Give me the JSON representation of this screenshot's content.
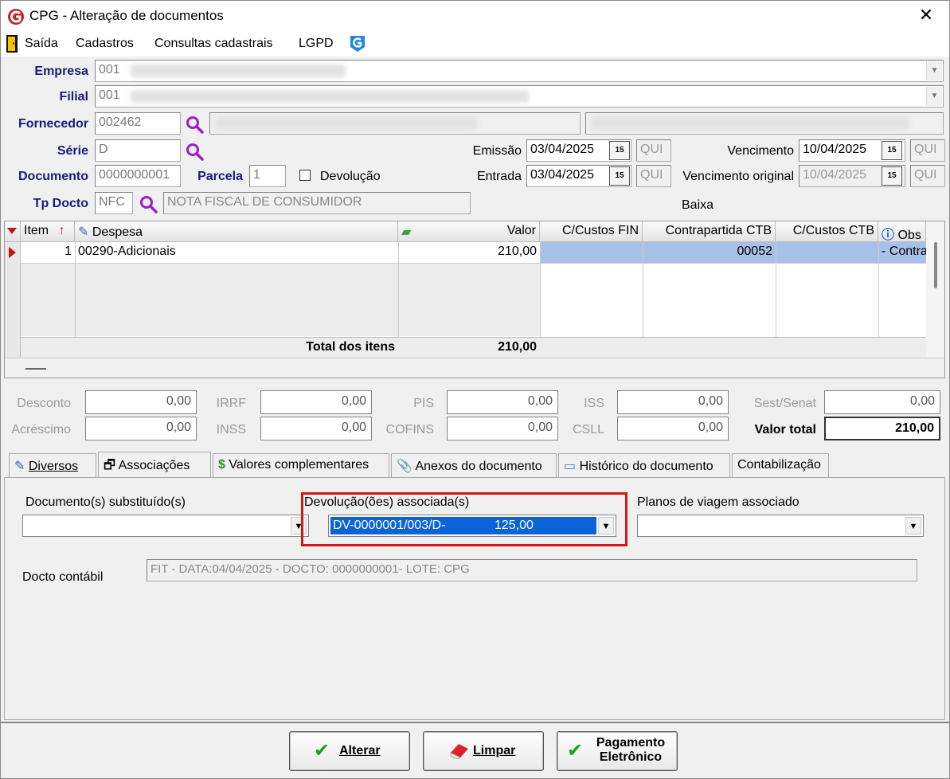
{
  "window": {
    "title": "CPG - Alteração de documentos",
    "close_label": "✕"
  },
  "menu": {
    "items": [
      "Saída",
      "Cadastros",
      "Consultas cadastrais",
      "LGPD"
    ]
  },
  "header": {
    "empresa_label": "Empresa",
    "empresa_value": "001",
    "filial_label": "Filial",
    "filial_value": "001",
    "fornecedor_label": "Fornecedor",
    "fornecedor_value": "002462",
    "serie_label": "Série",
    "serie_value": "D",
    "documento_label": "Documento",
    "documento_value": "0000000001",
    "parcela_label": "Parcela",
    "parcela_value": "1",
    "devolucao_label": "Devolução",
    "tpdocto_label": "Tp Docto",
    "tpdocto_value": "NFC",
    "tpdocto_desc": "NOTA FISCAL DE CONSUMIDOR",
    "emissao_label": "Emissão",
    "emissao_value": "03/04/2025",
    "emissao_day": "QUI",
    "entrada_label": "Entrada",
    "entrada_value": "03/04/2025",
    "entrada_day": "QUI",
    "vencimento_label": "Vencimento",
    "vencimento_value": "10/04/2025",
    "vencimento_day": "QUI",
    "venc_original_label": "Vencimento original",
    "venc_original_value": "10/04/2025",
    "venc_original_day": "QUI",
    "baixa_label": "Baixa",
    "cal_icon_text": "15"
  },
  "grid": {
    "columns": [
      "Item",
      "Despesa",
      "Valor",
      "C/Custos FIN",
      "Contrapartida CTB",
      "C/Custos CTB",
      "Obs"
    ],
    "rows": [
      {
        "item": "1",
        "despesa": "00290-Adicionais",
        "valor": "210,00",
        "ccfin": "",
        "contrapartida": "00052",
        "ccctb": "",
        "obs": "- Contra"
      }
    ],
    "total_label": "Total dos itens",
    "total_value": "210,00"
  },
  "totals": {
    "desconto_label": "Desconto",
    "desconto": "0,00",
    "irrf_label": "IRRF",
    "irrf": "0,00",
    "pis_label": "PIS",
    "pis": "0,00",
    "iss_label": "ISS",
    "iss": "0,00",
    "sest_label": "Sest/Senat",
    "sest": "0,00",
    "acrescimo_label": "Acréscimo",
    "acrescimo": "0,00",
    "inss_label": "INSS",
    "inss": "0,00",
    "cofins_label": "COFINS",
    "cofins": "0,00",
    "csll_label": "CSLL",
    "csll": "0,00",
    "valor_total_label": "Valor total",
    "valor_total": "210,00"
  },
  "tabs": [
    "Diversos",
    "Associações",
    "Valores complementares",
    "Anexos do documento",
    "Histórico do documento",
    "Contabilização"
  ],
  "panel": {
    "doc_subst_label": "Documento(s) substituído(s)",
    "devolucoes_label": "Devolução(ões) associada(s)",
    "devolucao_doc": "DV-0000001/003/D-",
    "devolucao_valor": "125,00",
    "planos_label": "Planos de viagem associado",
    "docto_contabil_label": "Docto contábil",
    "docto_contabil_value": "FIT - DATA:04/04/2025 - DOCTO: 0000000001- LOTE: CPG"
  },
  "buttons": {
    "alterar": "Alterar",
    "limpar": "Limpar",
    "pagamento_1": "Pagamento",
    "pagamento_2": "Eletrônico"
  },
  "colors": {
    "highlight": "#a8c1e8",
    "selection": "#0a64d8",
    "label_blue": "#1a1a7e",
    "red_frame": "#d01818"
  }
}
